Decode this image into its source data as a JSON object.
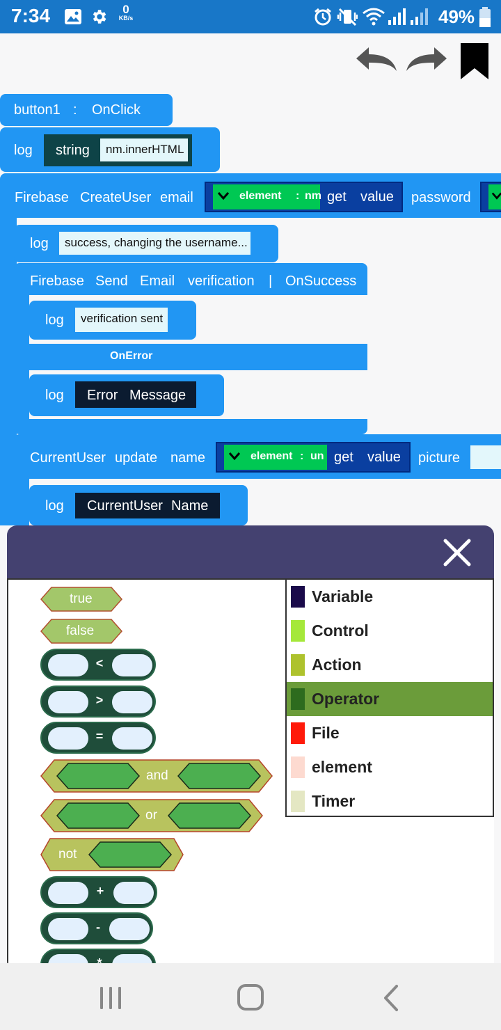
{
  "status_bar": {
    "time": "7:34",
    "net_speed": "0",
    "net_unit": "KB/s",
    "battery": "49%",
    "icons": [
      "image-icon",
      "settings-icon",
      "alarm-icon",
      "vibrate-icon",
      "wifi-icon",
      "signal-icon",
      "signal-icon-2",
      "battery-icon"
    ]
  },
  "toolbar": {
    "undo": "undo-icon",
    "redo": "redo-icon",
    "bookmark": "bookmark-icon"
  },
  "blocks": {
    "event": {
      "name": "button1",
      "sep": ":",
      "event": "OnClick"
    },
    "log1": {
      "label": "log",
      "type": "string",
      "value": "nm.innerHTML"
    },
    "firebase_create": {
      "label1": "Firebase",
      "label2": "CreateUser",
      "label3": "email",
      "element_label": "element",
      "element_sep": ":",
      "element_name": "nm",
      "get": "get",
      "value": "value",
      "password": "password"
    },
    "log2": {
      "label": "log",
      "value": "success, changing the username..."
    },
    "firebase_send": {
      "w1": "Firebase",
      "w2": "Send",
      "w3": "Email",
      "w4": "verification",
      "sep": "|",
      "event": "OnSuccess"
    },
    "log3": {
      "label": "log",
      "value": "verification sent"
    },
    "on_error": "OnError",
    "log4": {
      "label": "log",
      "v1": "Error",
      "v2": "Message"
    },
    "current_user": {
      "w1": "CurrentUser",
      "w2": "update",
      "w3": "name",
      "element_label": "element",
      "element_sep": ":",
      "element_name": "un",
      "get": "get",
      "value": "value",
      "picture": "picture"
    },
    "log5": {
      "label": "log",
      "v1": "CurrentUser",
      "v2": "Name"
    }
  },
  "palette": {
    "true_label": "true",
    "false_label": "false",
    "lt": "<",
    "gt": ">",
    "eq": "=",
    "and_label": "and",
    "or_label": "or",
    "not_label": "not",
    "plus": "+",
    "minus": "-",
    "times": "*"
  },
  "categories": [
    {
      "name": "Variable",
      "color": "#1a0a4a",
      "selected": false
    },
    {
      "name": "Control",
      "color": "#a5e83a",
      "selected": false
    },
    {
      "name": "Action",
      "color": "#aec22d",
      "selected": false
    },
    {
      "name": "Operator",
      "color": "#2d6b1e",
      "selected": true
    },
    {
      "name": "File",
      "color": "#ff1a0a",
      "selected": false
    },
    {
      "name": "element",
      "color": "#fddad0",
      "selected": false
    },
    {
      "name": "Timer",
      "color": "#e4e7c3",
      "selected": false
    }
  ],
  "colors": {
    "statusbar": "#1877c8",
    "block": "#2196f3",
    "dialog_header": "#444170",
    "selected_category": "#6b9c3a"
  }
}
